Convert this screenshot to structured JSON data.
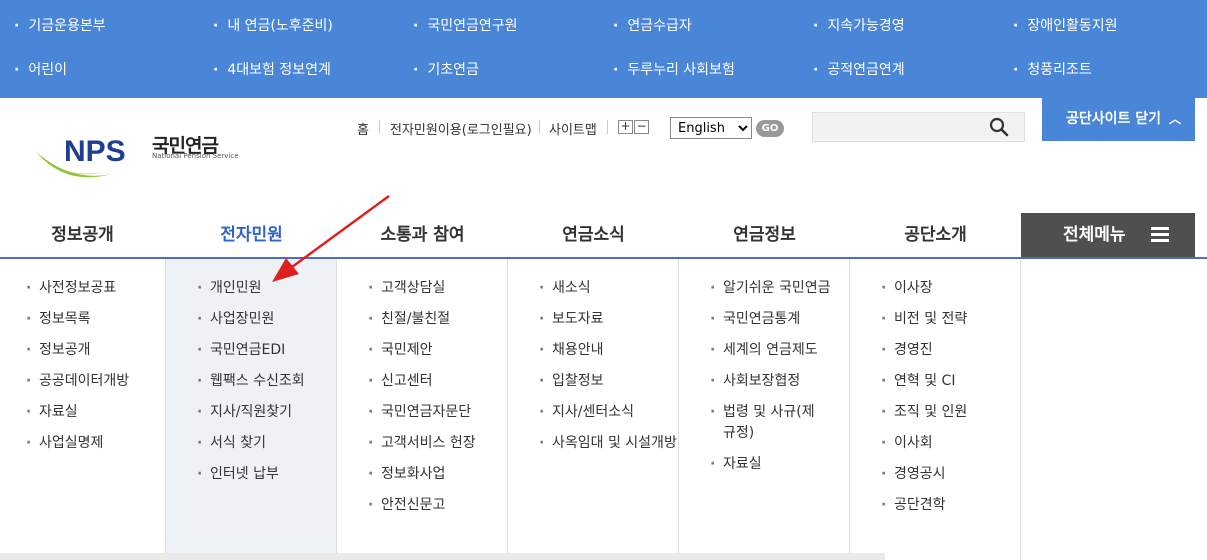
{
  "sites": [
    [
      "기금운용본부",
      "내 연금(노후준비)",
      "국민연금연구원",
      "연금수급자",
      "지속가능경영",
      "장애인활동지원"
    ],
    [
      "어린이",
      "4대보험 정보연계",
      "기초연금",
      "두루누리 사회보험",
      "공적연금연계",
      "청풍리조트"
    ]
  ],
  "logo": {
    "mark": "NPS",
    "text": "국민연금",
    "sub": "National Pension Service"
  },
  "util": {
    "home": "홈",
    "login": "전자민원이용(로그인필요)",
    "sitemap": "사이트맵",
    "zoom_in": "+",
    "zoom_out": "−"
  },
  "lang": {
    "selected": "English",
    "go": "GO"
  },
  "search": {
    "placeholder": ""
  },
  "close_sites": {
    "label": "공단사이트 닫기",
    "icon": "chevron-up-icon"
  },
  "gnb": [
    "정보공개",
    "전자민원",
    "소통과 참여",
    "연금소식",
    "연금정보",
    "공단소개"
  ],
  "all_menu": {
    "label": "전체메뉴",
    "icon": "hamburger-icon"
  },
  "submenus": [
    [
      "사전정보공표",
      "정보목록",
      "정보공개",
      "공공데이터개방",
      "자료실",
      "사업실명제"
    ],
    [
      "개인민원",
      "사업장민원",
      "국민연금EDI",
      "웹팩스 수신조회",
      "지사/직원찾기",
      "서식 찾기",
      "인터넷 납부"
    ],
    [
      "고객상담실",
      "친절/불친절",
      "국민제안",
      "신고센터",
      "국민연금자문단",
      "고객서비스 헌장",
      "정보화사업",
      "안전신문고"
    ],
    [
      "새소식",
      "보도자료",
      "채용안내",
      "입찰정보",
      "지사/센터소식",
      "사옥임대 및 시설개방"
    ],
    [
      "알기쉬운 국민연금",
      "국민연금통계",
      "세계의 연금제도",
      "사회보장협정",
      "법령 및 사규(제규정)",
      "자료실"
    ],
    [
      "이사장",
      "비전 및 전략",
      "경영진",
      "연혁 및 CI",
      "조직 및 인원",
      "이사회",
      "경영공시",
      "공단견학"
    ]
  ],
  "colors": {
    "blue": "#4a86d8",
    "active": "#2f65c9",
    "dark": "#4f4f4f",
    "arrow": "#e02020"
  }
}
